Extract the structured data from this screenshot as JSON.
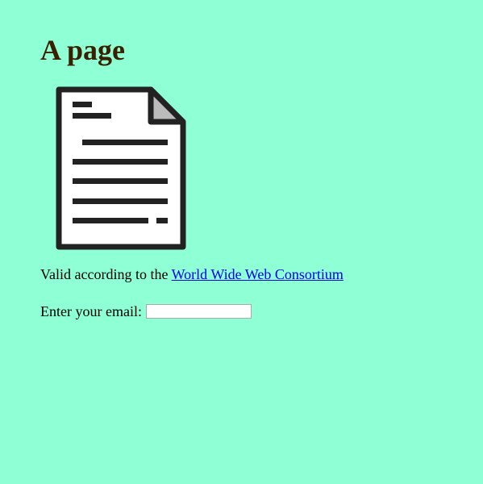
{
  "page": {
    "heading": "A page",
    "validity_text": "Valid according to the ",
    "validity_link": "World Wide Web Consortium",
    "email_label": "Enter your email:",
    "email_value": "",
    "email_placeholder": ""
  },
  "document_icon": {
    "icon": "document-icon"
  },
  "colors": {
    "background": "#8fffd6",
    "heading": "#3a1f00",
    "link": "#0000ee",
    "icon_stroke": "#222222",
    "icon_fold": "#bbbbbb"
  }
}
